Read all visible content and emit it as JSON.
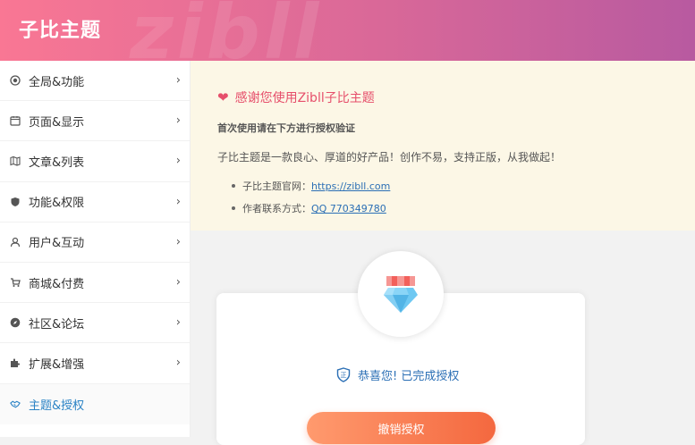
{
  "header": {
    "title": "子比主题",
    "watermark": "zibll"
  },
  "sidebar": {
    "items": [
      {
        "label": "全局&功能",
        "icon": "target-icon"
      },
      {
        "label": "页面&显示",
        "icon": "calendar-icon"
      },
      {
        "label": "文章&列表",
        "icon": "map-icon"
      },
      {
        "label": "功能&权限",
        "icon": "shield-icon"
      },
      {
        "label": "用户&互动",
        "icon": "user-icon"
      },
      {
        "label": "商城&付费",
        "icon": "cart-icon"
      },
      {
        "label": "社区&论坛",
        "icon": "compass-icon"
      },
      {
        "label": "扩展&增强",
        "icon": "puzzle-icon"
      },
      {
        "label": "主题&授权",
        "icon": "handshake-icon",
        "active": true
      }
    ]
  },
  "notice": {
    "heading": "感谢您使用Zibll子比主题",
    "subheading": "首次使用请在下方进行授权验证",
    "description": "子比主题是一款良心、厚道的好产品！创作不易，支持正版，从我做起！",
    "links": [
      {
        "label": "子比主题官网：",
        "value": "https://zibll.com"
      },
      {
        "label": "作者联系方式：",
        "value": "QQ 770349780"
      }
    ]
  },
  "auth": {
    "status": "恭喜您! 已完成授权",
    "revoke_label": "撤销授权",
    "icon": "diamond-icon"
  },
  "colors": {
    "accent": "#e64f6b",
    "link": "#2b6fb5",
    "button": "#f4683f"
  }
}
